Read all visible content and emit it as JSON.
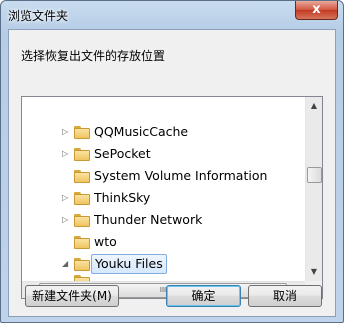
{
  "window": {
    "title": "浏览文件夹",
    "close_label": "x",
    "prompt": "选择恢复出文件的存放位置"
  },
  "tree": {
    "items": [
      {
        "label": "QQMusicCache",
        "expandable": true,
        "expanded": false,
        "selected": false
      },
      {
        "label": "SePocket",
        "expandable": true,
        "expanded": false,
        "selected": false
      },
      {
        "label": "System Volume Information",
        "expandable": false,
        "expanded": false,
        "selected": false
      },
      {
        "label": "ThinkSky",
        "expandable": true,
        "expanded": false,
        "selected": false
      },
      {
        "label": "Thunder Network",
        "expandable": true,
        "expanded": false,
        "selected": false
      },
      {
        "label": "wto",
        "expandable": false,
        "expanded": false,
        "selected": false
      },
      {
        "label": "Youku Files",
        "expandable": true,
        "expanded": true,
        "selected": true
      }
    ],
    "vscroll": {
      "up_arrow": "▲",
      "down_arrow": "▼"
    },
    "hscroll": {
      "left_arrow": "◀",
      "right_arrow": "▶",
      "grip": "III"
    }
  },
  "buttons": {
    "new_folder": "新建文件夹(M)",
    "ok": "确定",
    "cancel": "取消"
  },
  "icons": {
    "folder": "folder-icon",
    "collapsed": "triangle-right-icon",
    "expanded": "triangle-down-icon"
  }
}
